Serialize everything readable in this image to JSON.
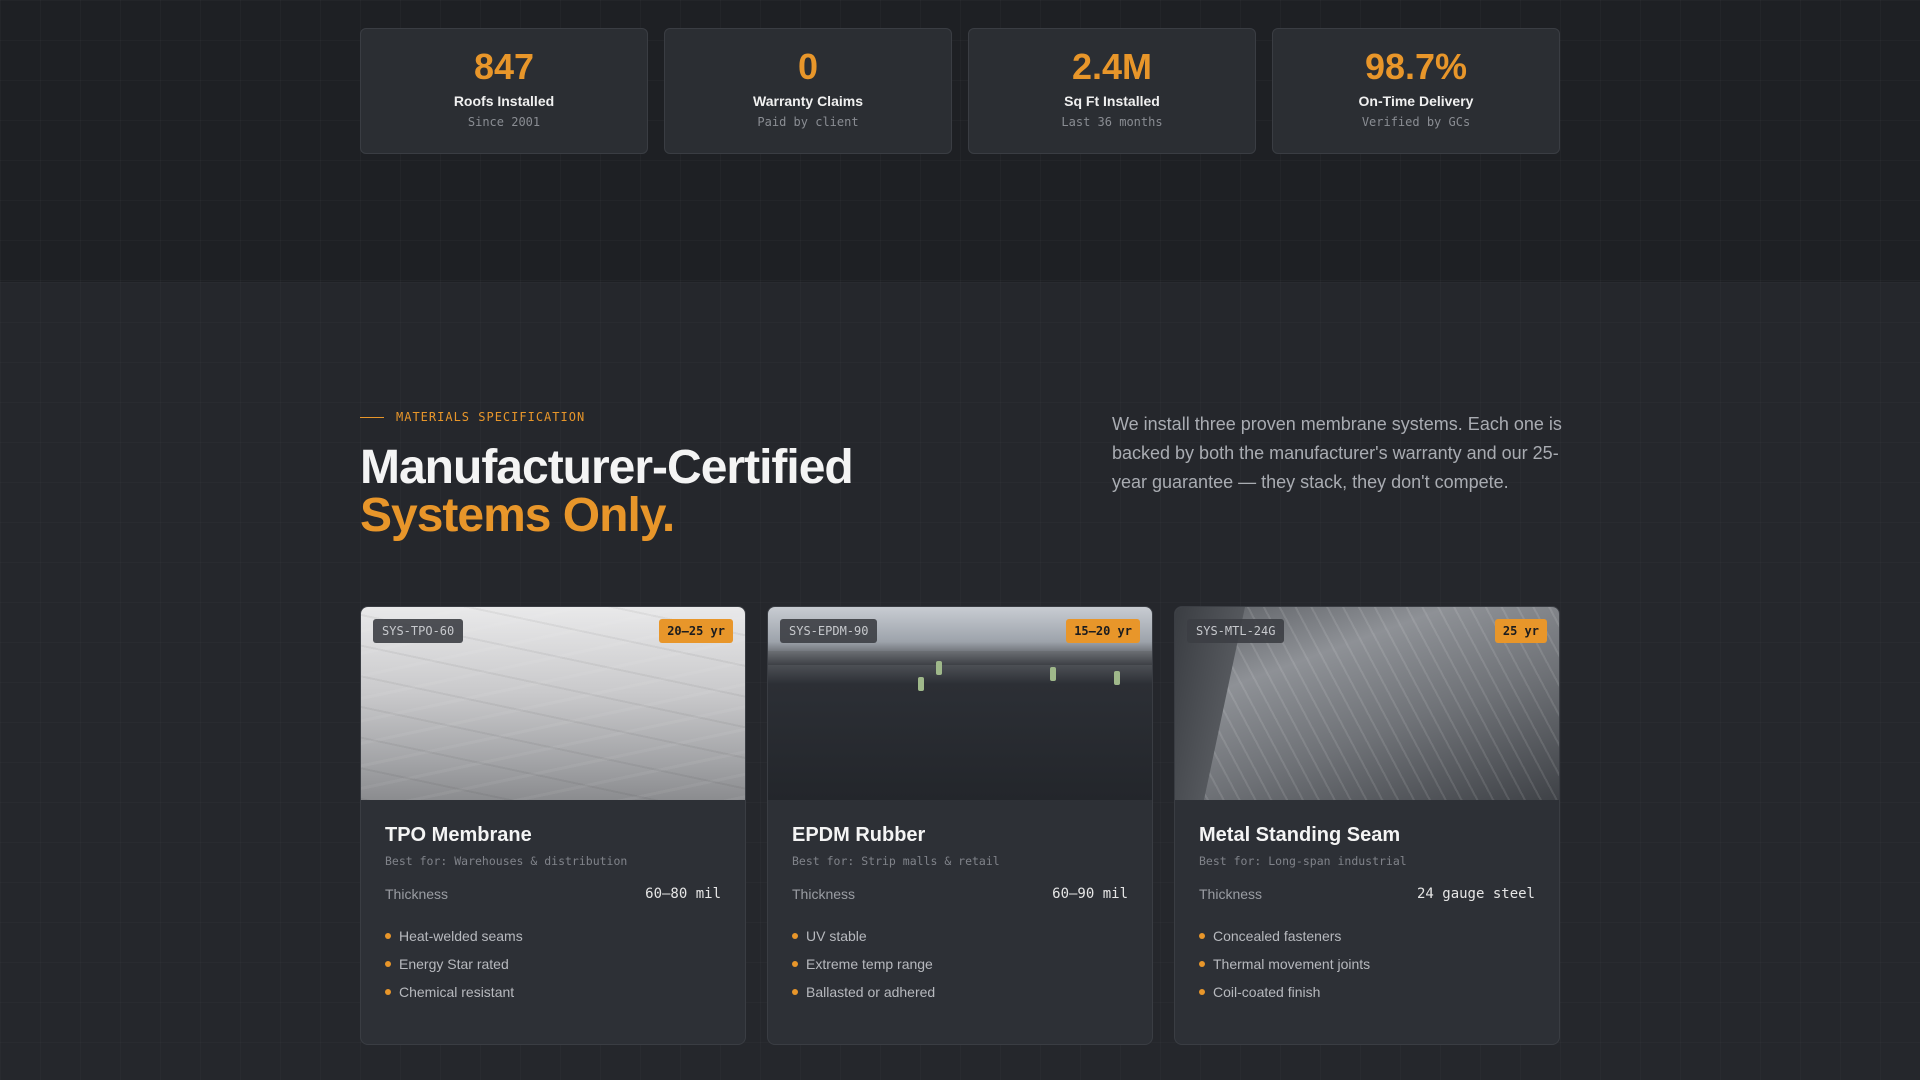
{
  "stats": [
    {
      "value": "847",
      "label": "Roofs Installed",
      "sub": "Since 2001"
    },
    {
      "value": "0",
      "label": "Warranty Claims",
      "sub": "Paid by client"
    },
    {
      "value": "2.4M",
      "label": "Sq Ft Installed",
      "sub": "Last 36 months"
    },
    {
      "value": "98.7%",
      "label": "On-Time Delivery",
      "sub": "Verified by GCs"
    }
  ],
  "section": {
    "eyebrow": "MATERIALS SPECIFICATION",
    "headline_line1": "Manufacturer-Certified",
    "headline_line2": "Systems Only.",
    "intro": "We install three proven membrane systems. Each one is backed by both the manufacturer's warranty and our 25-year guarantee — they stack, they don't compete."
  },
  "cards": [
    {
      "code": "SYS-TPO-60",
      "warranty": "20–25 yr",
      "title": "TPO Membrane",
      "best_for": "Best for: Warehouses & distribution",
      "spec_label": "Thickness",
      "spec_value": "60–80 mil",
      "features": [
        "Heat-welded seams",
        "Energy Star rated",
        "Chemical resistant"
      ]
    },
    {
      "code": "SYS-EPDM-90",
      "warranty": "15–20 yr",
      "title": "EPDM Rubber",
      "best_for": "Best for: Strip malls & retail",
      "spec_label": "Thickness",
      "spec_value": "60–90 mil",
      "features": [
        "UV stable",
        "Extreme temp range",
        "Ballasted or adhered"
      ]
    },
    {
      "code": "SYS-MTL-24G",
      "warranty": "25 yr",
      "title": "Metal Standing Seam",
      "best_for": "Best for: Long-span industrial",
      "spec_label": "Thickness",
      "spec_value": "24 gauge steel",
      "features": [
        "Concealed fasteners",
        "Thermal movement joints",
        "Coil-coated finish"
      ]
    }
  ],
  "colors": {
    "accent": "#e8962a",
    "background": "#25272c",
    "card": "#2d3036"
  }
}
